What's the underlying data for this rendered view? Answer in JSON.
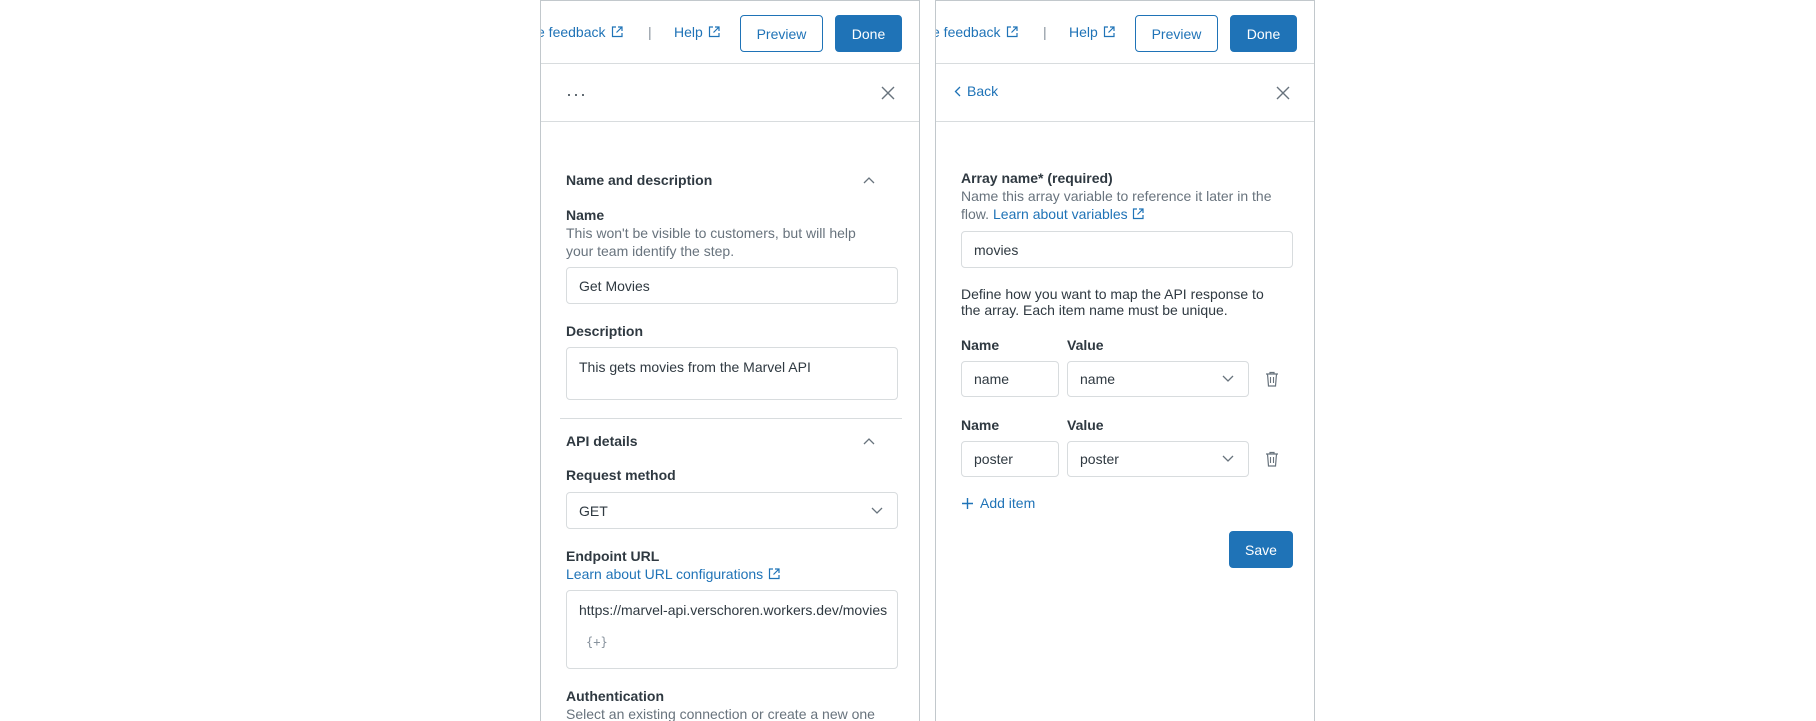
{
  "topbar": {
    "feedback_label": "e feedback",
    "help_label": "Help",
    "separator": "|",
    "preview_label": "Preview",
    "done_label": "Done"
  },
  "left_panel": {
    "menu_label": "···",
    "name_section": {
      "title": "Name and description",
      "name_label": "Name",
      "name_hint": "This won't be visible to customers, but will help your team identify the step.",
      "name_value": "Get Movies",
      "description_label": "Description",
      "description_value": "This gets movies from the Marvel API"
    },
    "api_section": {
      "title": "API details",
      "method_label": "Request method",
      "method_value": "GET",
      "endpoint_label": "Endpoint URL",
      "endpoint_link": "Learn about URL configurations",
      "endpoint_value": "https://marvel-api.verschoren.workers.dev/movies",
      "variable_icon": "{+}",
      "auth_label": "Authentication",
      "auth_hint": "Select an existing connection or create a new one"
    }
  },
  "right_panel": {
    "back_label": "Back",
    "array_name_label": "Array name* (required)",
    "array_hint_line1": "Name this array variable to reference it later in the",
    "array_hint_line2_prefix": "flow.",
    "array_hint_link": "Learn about variables",
    "array_name_value": "movies",
    "mapping_hint_line1": "Define how you want to map the API response to",
    "mapping_hint_line2": "the array. Each item name must be unique.",
    "items": [
      {
        "name_label": "Name",
        "value_label": "Value",
        "name_value": "name",
        "value_selected": "name"
      },
      {
        "name_label": "Name",
        "value_label": "Value",
        "name_value": "poster",
        "value_selected": "poster"
      }
    ],
    "add_item_label": "Add item",
    "save_label": "Save"
  },
  "colors": {
    "accent": "#1f73b7",
    "border": "#d8dcde",
    "text": "#2f3941",
    "muted": "#68737d"
  }
}
